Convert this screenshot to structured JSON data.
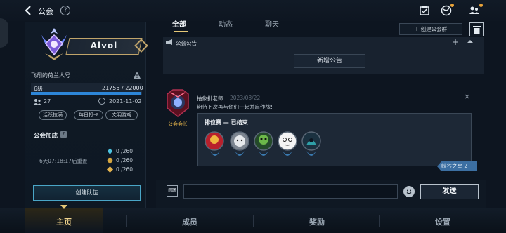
{
  "header": {
    "title": "公会",
    "help": "?"
  },
  "guild": {
    "name": "Alvol",
    "owner": "飞翔的荷兰人号",
    "level": "6级",
    "xp": "21755 / 22000",
    "xp_progress": 0.989,
    "members": "27",
    "created": "2021-11-02",
    "tags": [
      "活跃拉满",
      "每日打卡",
      "文明游戏"
    ]
  },
  "bonus": {
    "title": "公会加成",
    "reset": "6天07:18:17后重置",
    "rows": [
      "0 /260",
      "0 /260",
      "0 /260"
    ]
  },
  "left_panel": {
    "create_team": "创建队伍"
  },
  "tabs": [
    "全部",
    "动态",
    "聊天"
  ],
  "toolbar": {
    "create_group": "+ 创建公会群"
  },
  "announcement": {
    "label": "公会公告",
    "plus": "+",
    "add_button": "新增公告"
  },
  "message": {
    "sender": "抽象批老师",
    "date": "2023/08/22",
    "text": "期待下次再与你们一起并肩作战!",
    "role_badge": "公会会长",
    "close": "×",
    "card_title": "排位赛 — 已结束",
    "card_tag": "峡谷之星 2"
  },
  "input": {
    "keyboard_label": "⌨",
    "placeholder": "",
    "send": "发送"
  },
  "nav": [
    "主页",
    "成员",
    "奖励",
    "设置"
  ],
  "colors": {
    "accent_gold": "#e6c877",
    "accent_blue": "#2d86d8",
    "nav_active": "#f0d38c"
  }
}
